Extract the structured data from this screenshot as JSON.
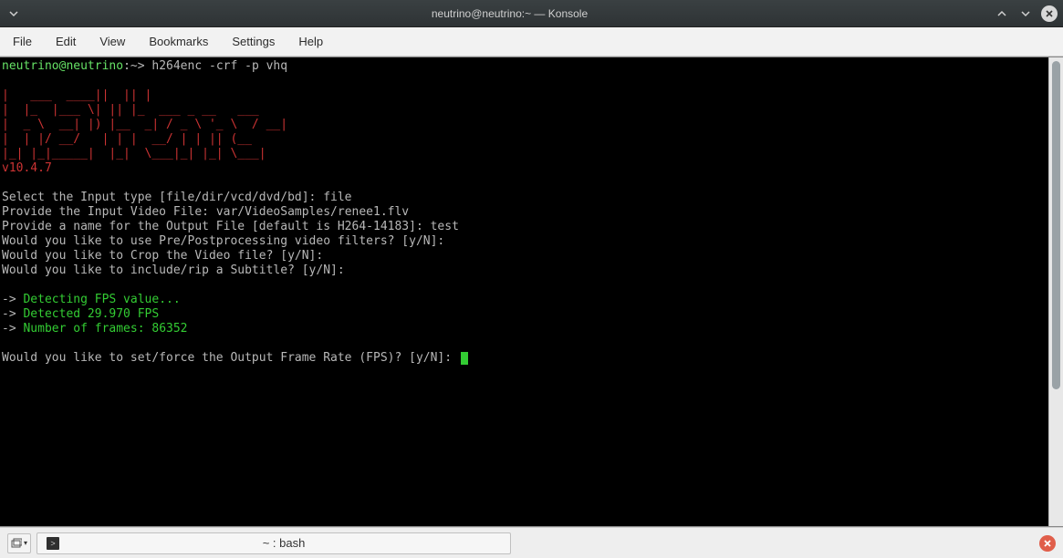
{
  "window": {
    "title": "neutrino@neutrino:~ — Konsole"
  },
  "menu": {
    "file": "File",
    "edit": "Edit",
    "view": "View",
    "bookmarks": "Bookmarks",
    "settings": "Settings",
    "help": "Help"
  },
  "terminal": {
    "prompt_user": "neutrino@neutrino",
    "prompt_path": ":~> ",
    "command": "h264enc -crf -p vhq",
    "ascii_art": "|   ___  ____||  || |                     \n|  |_  |___ \\| || |_  ___ _ __   ___ \n|  _ \\  __| |) |__  _| / _ \\ '_ \\  / __|\n|  | |/ __/   | | |  __/ | | || (__ \n|_| |_|_____|  |_|  \\___|_| |_| \\___|",
    "version": "v10.4.7",
    "line_select_prompt": "Select the Input type [file/dir/vcd/dvd/bd]: ",
    "line_select_answer": "file",
    "line_input_prompt": "Provide the Input Video File: ",
    "line_input_answer": "var/VideoSamples/renee1.flv",
    "line_output_prompt": "Provide a name for the Output File [default is H264-14183]: ",
    "line_output_answer": "test",
    "line_filters": "Would you like to use Pre/Postprocessing video filters? [y/N]:",
    "line_crop": "Would you like to Crop the Video file? [y/N]:",
    "line_subtitle": "Would you like to include/rip a Subtitle? [y/N]:",
    "detect_arrow": "-> ",
    "detect_fps": "Detecting FPS value...",
    "detected_fps": "Detected 29.970 FPS",
    "num_frames": "Number of frames: 86352",
    "line_force_fps": "Would you like to set/force the Output Frame Rate (FPS)? [y/N]: "
  },
  "status": {
    "tab_label": "~ : bash"
  }
}
